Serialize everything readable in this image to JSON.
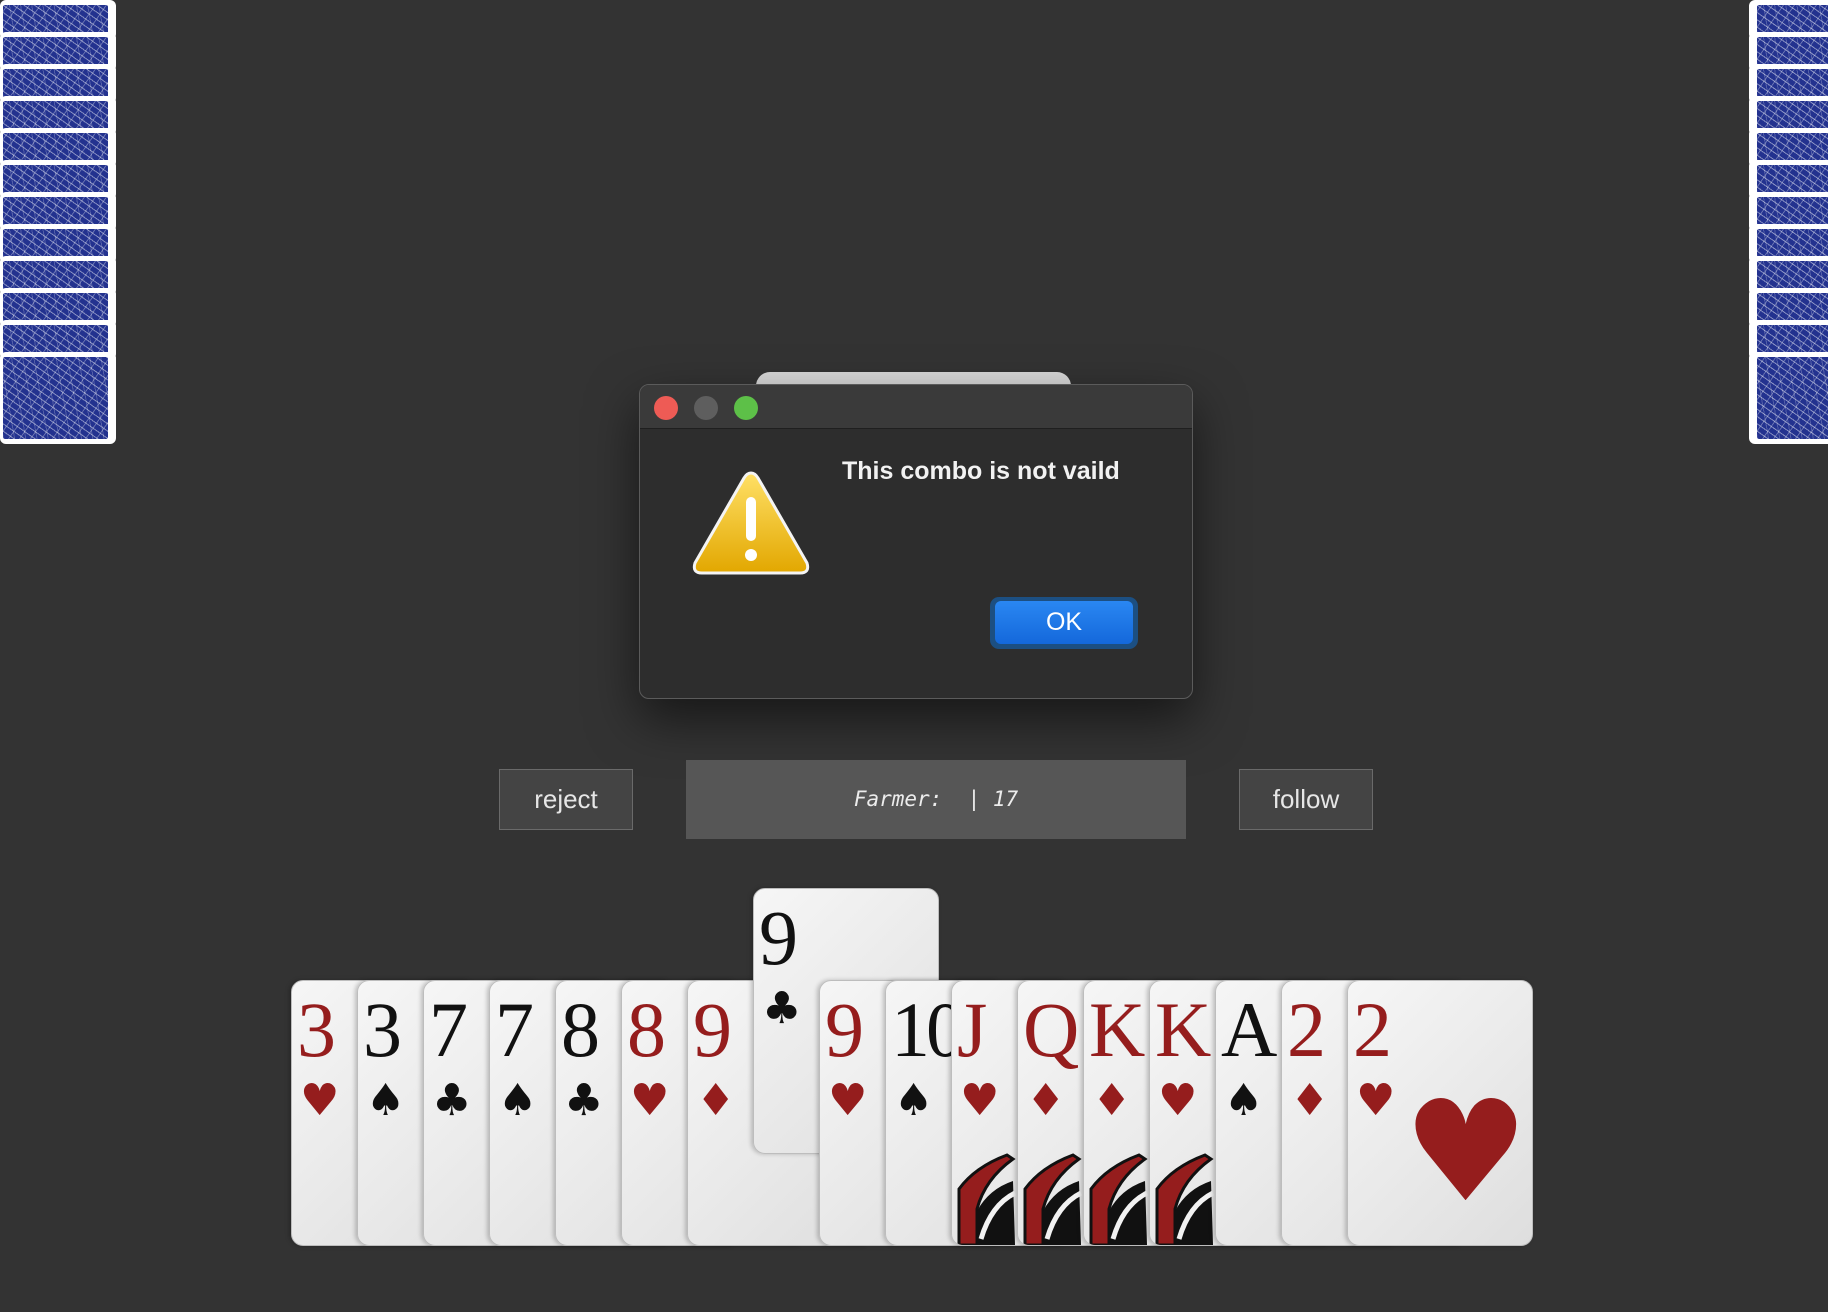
{
  "opponents": {
    "left": {
      "card_count": 12,
      "card_back_color": "#23328f"
    },
    "right": {
      "card_count": 12,
      "card_back_color": "#23328f"
    }
  },
  "dialog": {
    "message": "This combo is not vaild",
    "ok_label": "OK",
    "icon": "warning-icon",
    "window_controls": [
      "close",
      "minimize",
      "zoom"
    ]
  },
  "controls": {
    "reject_label": "reject",
    "follow_label": "follow",
    "status_text": "Farmer:  | 17"
  },
  "hand": {
    "selected_index": 7,
    "cards": [
      {
        "rank": "3",
        "suit": "♥",
        "color": "red"
      },
      {
        "rank": "3",
        "suit": "♠",
        "color": "black"
      },
      {
        "rank": "7",
        "suit": "♣",
        "color": "black"
      },
      {
        "rank": "7",
        "suit": "♠",
        "color": "black"
      },
      {
        "rank": "8",
        "suit": "♣",
        "color": "black"
      },
      {
        "rank": "8",
        "suit": "♥",
        "color": "red"
      },
      {
        "rank": "9",
        "suit": "♦",
        "color": "red"
      },
      {
        "rank": "9",
        "suit": "♣",
        "color": "black"
      },
      {
        "rank": "9",
        "suit": "♥",
        "color": "red"
      },
      {
        "rank": "10",
        "suit": "♠",
        "color": "black"
      },
      {
        "rank": "J",
        "suit": "♥",
        "color": "red",
        "face": true
      },
      {
        "rank": "Q",
        "suit": "♦",
        "color": "red",
        "face": true
      },
      {
        "rank": "K",
        "suit": "♦",
        "color": "red",
        "face": true
      },
      {
        "rank": "K",
        "suit": "♥",
        "color": "red",
        "face": true
      },
      {
        "rank": "A",
        "suit": "♠",
        "color": "black"
      },
      {
        "rank": "2",
        "suit": "♦",
        "color": "red"
      },
      {
        "rank": "2",
        "suit": "♥",
        "color": "red"
      }
    ]
  },
  "colors": {
    "table": "#333333",
    "red_suit": "#951d1d",
    "ok_button": "#1468db"
  }
}
